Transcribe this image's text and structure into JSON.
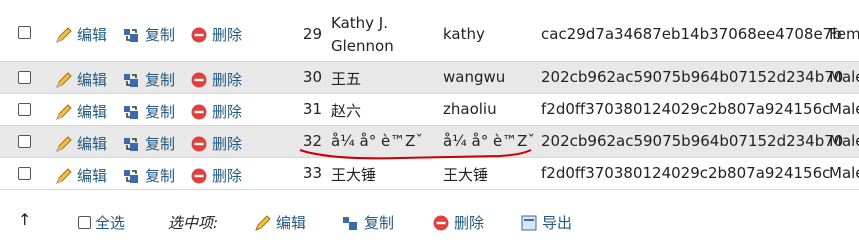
{
  "actions": {
    "edit_label": "编辑",
    "copy_label": "复制",
    "delete_label": "删除"
  },
  "rows": [
    {
      "id": "29",
      "name_line1": "Kathy J.",
      "name_line2": "Glennon",
      "username": "kathy",
      "password": "cac29d7a34687eb14b37068ee4708e7b",
      "gender": "Fem"
    },
    {
      "id": "30",
      "name": "王五",
      "username": "wangwu",
      "password": "202cb962ac59075b964b07152d234b70",
      "gender": "Male"
    },
    {
      "id": "31",
      "name": "赵六",
      "username": "zhaoliu",
      "password": "f2d0ff370380124029c2b807a924156c",
      "gender": "Male"
    },
    {
      "id": "32",
      "name": "å¼ å°   è™Zˇ",
      "username": "å¼ å°   è™Zˇ",
      "password": "202cb962ac59075b964b07152d234b70",
      "gender": "Male"
    },
    {
      "id": "33",
      "name": "王大锤",
      "username": "王大锤",
      "password": "f2d0ff370380124029c2b807a924156c",
      "gender": "Male"
    }
  ],
  "bulk": {
    "select_all": "全选",
    "with_selected": "选中项:",
    "edit": "编辑",
    "copy": "复制",
    "delete": "删除",
    "export": "导出"
  },
  "colors": {
    "link": "#235a81",
    "alt_row": "#e8e8e8",
    "annotation": "#cc0000"
  }
}
